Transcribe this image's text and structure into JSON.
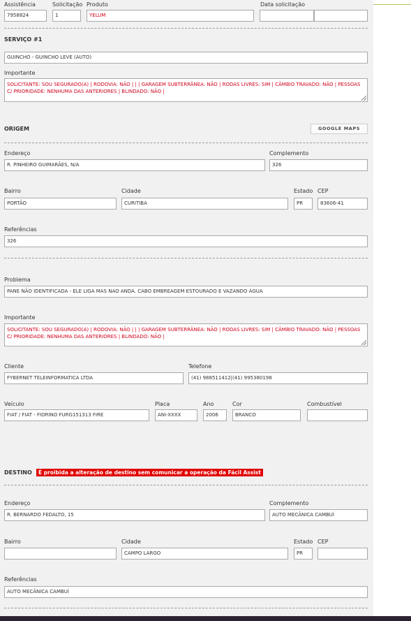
{
  "top": {
    "assistencia_label": "Assistência",
    "assistencia_value": "7958824",
    "solicitacao_label": "Solicitação",
    "solicitacao_value": "1",
    "produto_label": "Produto",
    "produto_value": "YELUM",
    "data_label": "Data solicitação",
    "data_value": "",
    "hora_value": ""
  },
  "servico": {
    "title": "SERVIÇO #1",
    "tipo": "GUINCHO - GUINCHO LEVE (AUTO)",
    "importante_label": "Importante",
    "importante_text": "SOLICITANTE: SOU SEGURADO(A) | RODOVIA: NÃO | | | GARAGEM SUBTERRÂNEA: NÃO | RODAS LIVRES: SIM | CÂMBIO TRAVADO: NÃO | PESSOAS C/ PRIORIDADE: NENHUMA DAS ANTERIORES | BLINDADO: NÃO |"
  },
  "origem": {
    "title": "ORIGEM",
    "maps_button": "GOOGLE MAPS",
    "endereco_label": "Endereço",
    "endereco": "R. PINHEIRO GUIMARÃES, N/A",
    "complemento_label": "Complemento",
    "complemento": "326",
    "bairro_label": "Bairro",
    "bairro": "PORTÃO",
    "cidade_label": "Cidade",
    "cidade": "CURITIBA",
    "estado_label": "Estado",
    "estado": "PR",
    "cep_label": "CEP",
    "cep": "83606-41",
    "referencias_label": "Referências",
    "referencias": "326"
  },
  "problema": {
    "problema_label": "Problema",
    "problema": "PANE NÃO IDENTIFICADA - ELE LIGA MAS NAO ANDA. CABO EMBREAGEM ESTOURADO E VAZANDO ÁGUA",
    "importante_label": "Importante",
    "importante_text": "SOLICITANTE: SOU SEGURADO(A) | RODOVIA: NÃO | | | GARAGEM SUBTERRÂNEA: NÃO | RODAS LIVRES: SIM | CÂMBIO TRAVADO: NÃO | PESSOAS C/ PRIORIDADE: NENHUMA DAS ANTERIORES | BLINDADO: NÃO |",
    "cliente_label": "Cliente",
    "cliente": "FYBERNET TELEINFORMATICA LTDA",
    "telefone_label": "Telefone",
    "telefone": "(41) 988511412|(41) 995380198",
    "veiculo_label": "Veículo",
    "veiculo": "FIAT / FIAT - FIORINO FURG151313 FIRE",
    "placa_label": "Placa",
    "placa": "ANI-XXXX",
    "ano_label": "Ano",
    "ano": "2006",
    "cor_label": "Cor",
    "cor": "BRANCO",
    "combustivel_label": "Combustível",
    "combustivel": ""
  },
  "destino": {
    "title": "DESTINO",
    "warning": "É proibida a alteração de destino sem comunicar a operação da Fácil Assist",
    "endereco_label": "Endereço",
    "endereco": "R. BERNARDO FEDALTO, 15",
    "complemento_label": "Complemento",
    "complemento": "AUTO MECÂNICA CAMBUÍ",
    "bairro_label": "Bairro",
    "bairro": "",
    "cidade_label": "Cidade",
    "cidade": "CAMPO LARGO",
    "estado_label": "Estado",
    "estado": "PR",
    "cep_label": "CEP",
    "cep": "",
    "referencias_label": "Referências",
    "referencias": "AUTO MECÂNICA CAMBUÍ"
  },
  "colors": {
    "alert_red": "#d0021b",
    "warning_bg": "#e00000",
    "panel_bg": "#f1f1f1"
  }
}
